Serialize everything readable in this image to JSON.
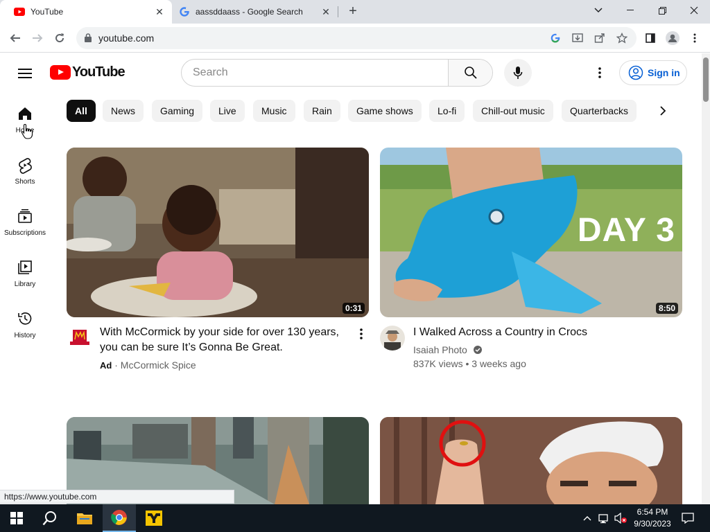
{
  "browser": {
    "tabs": [
      {
        "title": "YouTube",
        "favicon": "youtube-icon",
        "active": true
      },
      {
        "title": "aassddaass - Google Search",
        "favicon": "google-icon",
        "active": false
      }
    ],
    "new_tab_label": "+",
    "url": "youtube.com",
    "status_url": "https://www.youtube.com"
  },
  "youtube": {
    "logo_text": "YouTube",
    "search_placeholder": "Search",
    "signin_label": "Sign in",
    "brand_color": "#ff0000",
    "link_color": "#065fd4"
  },
  "sidebar": {
    "items": [
      {
        "label": "Home",
        "icon": "home-icon"
      },
      {
        "label": "Shorts",
        "icon": "shorts-icon"
      },
      {
        "label": "Subscriptions",
        "icon": "subscriptions-icon"
      },
      {
        "label": "Library",
        "icon": "library-icon"
      },
      {
        "label": "History",
        "icon": "history-icon"
      }
    ]
  },
  "chips": [
    "All",
    "News",
    "Gaming",
    "Live",
    "Music",
    "Rain",
    "Game shows",
    "Lo-fi",
    "Chill-out music",
    "Quarterbacks"
  ],
  "videos": [
    {
      "title_line1": "With McCormick by your side for over 130 years,",
      "title_line2": "you can be sure It’s Gonna Be Great.",
      "ad_label": "Ad",
      "separator": "·",
      "channel": "McCormick Spice",
      "duration": "0:31"
    },
    {
      "title": "I Walked Across a Country in Crocs",
      "channel": "Isaiah Photo",
      "stats": "837K views • 3 weeks ago",
      "duration": "8:50",
      "overlay_text": "DAY 3"
    }
  ],
  "taskbar": {
    "time": "6:54 PM",
    "date": "9/30/2023"
  }
}
